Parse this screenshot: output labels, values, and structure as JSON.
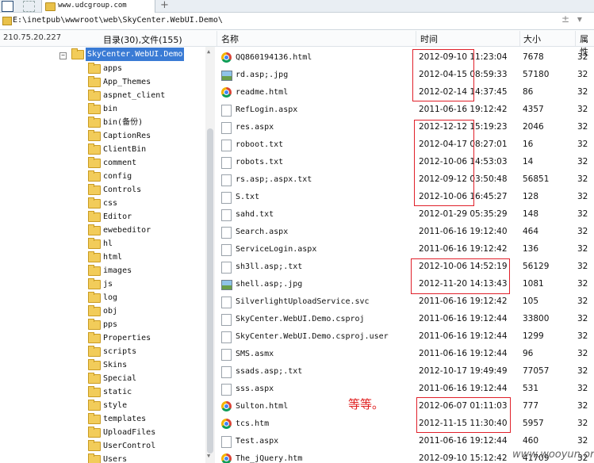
{
  "tabs": {
    "active_label": "www.udcgroup.com",
    "add_label": "+"
  },
  "path": {
    "text": "E:\\inetpub\\wwwroot\\web\\SkyCenter.WebUI.Demo\\",
    "controls": "± ▾"
  },
  "header": {
    "ip": "210.75.20.227",
    "counts": "目录(30),文件(155)",
    "col_name": "名称",
    "col_time": "时间",
    "col_size": "大小",
    "col_attr": "属性"
  },
  "tree": {
    "root": "SkyCenter.WebUI.Demo",
    "folders": [
      "apps",
      "App_Themes",
      "aspnet_client",
      "bin",
      "bin(备份)",
      "CaptionRes",
      "ClientBin",
      "comment",
      "config",
      "Controls",
      "css",
      "Editor",
      "ewebeditor",
      "hl",
      "html",
      "images",
      "js",
      "log",
      "obj",
      "pps",
      "Properties",
      "scripts",
      "Skins",
      "Special",
      "static",
      "style",
      "templates",
      "UploadFiles",
      "UserControl",
      "Users"
    ]
  },
  "files": [
    {
      "icon": "chrome",
      "name": "QQ860194136.html",
      "time": "2012-09-10 11:23:04",
      "size": "7678",
      "attr": "32"
    },
    {
      "icon": "image",
      "name": "rd.asp;.jpg",
      "time": "2012-04-15 08:59:33",
      "size": "57180",
      "attr": "32"
    },
    {
      "icon": "chrome",
      "name": "readme.html",
      "time": "2012-02-14 14:37:45",
      "size": "86",
      "attr": "32"
    },
    {
      "icon": "page",
      "name": "RefLogin.aspx",
      "time": "2011-06-16 19:12:42",
      "size": "4357",
      "attr": "32"
    },
    {
      "icon": "page",
      "name": "res.aspx",
      "time": "2012-12-12 15:19:23",
      "size": "2046",
      "attr": "32"
    },
    {
      "icon": "page",
      "name": "roboot.txt",
      "time": "2012-04-17 08:27:01",
      "size": "16",
      "attr": "32"
    },
    {
      "icon": "page",
      "name": "robots.txt",
      "time": "2012-10-06 14:53:03",
      "size": "14",
      "attr": "32"
    },
    {
      "icon": "page",
      "name": "rs.asp;.aspx.txt",
      "time": "2012-09-12 03:50:48",
      "size": "56851",
      "attr": "32"
    },
    {
      "icon": "page",
      "name": "S.txt",
      "time": "2012-10-06 16:45:27",
      "size": "128",
      "attr": "32"
    },
    {
      "icon": "page",
      "name": "sahd.txt",
      "time": "2012-01-29 05:35:29",
      "size": "148",
      "attr": "32"
    },
    {
      "icon": "page",
      "name": "Search.aspx",
      "time": "2011-06-16 19:12:40",
      "size": "464",
      "attr": "32"
    },
    {
      "icon": "page",
      "name": "ServiceLogin.aspx",
      "time": "2011-06-16 19:12:42",
      "size": "136",
      "attr": "32"
    },
    {
      "icon": "page",
      "name": "sh3ll.asp;.txt",
      "time": "2012-10-06 14:52:19",
      "size": "56129",
      "attr": "32"
    },
    {
      "icon": "image",
      "name": "shell.asp;.jpg",
      "time": "2012-11-20 14:13:43",
      "size": "1081",
      "attr": "32"
    },
    {
      "icon": "page",
      "name": "SilverlightUploadService.svc",
      "time": "2011-06-16 19:12:42",
      "size": "105",
      "attr": "32"
    },
    {
      "icon": "page",
      "name": "SkyCenter.WebUI.Demo.csproj",
      "time": "2011-06-16 19:12:44",
      "size": "33800",
      "attr": "32"
    },
    {
      "icon": "page",
      "name": "SkyCenter.WebUI.Demo.csproj.user",
      "time": "2011-06-16 19:12:44",
      "size": "1299",
      "attr": "32"
    },
    {
      "icon": "page",
      "name": "SMS.asmx",
      "time": "2011-06-16 19:12:44",
      "size": "96",
      "attr": "32"
    },
    {
      "icon": "page",
      "name": "ssads.asp;.txt",
      "time": "2012-10-17 19:49:49",
      "size": "77057",
      "attr": "32"
    },
    {
      "icon": "page",
      "name": "sss.aspx",
      "time": "2011-06-16 19:12:44",
      "size": "531",
      "attr": "32"
    },
    {
      "icon": "chrome",
      "name": "Sulton.html",
      "time": "2012-06-07 01:11:03",
      "size": "777",
      "attr": "32"
    },
    {
      "icon": "chrome",
      "name": "tcs.htm",
      "time": "2012-11-15 11:30:40",
      "size": "5957",
      "attr": "32"
    },
    {
      "icon": "page",
      "name": "Test.aspx",
      "time": "2011-06-16 19:12:44",
      "size": "460",
      "attr": "32"
    },
    {
      "icon": "chrome",
      "name": "The_jQuery.htm",
      "time": "2012-09-10 15:12:42",
      "size": "41709",
      "attr": "32"
    }
  ],
  "annotation": "等等。",
  "watermark": "www.wooyun.org"
}
